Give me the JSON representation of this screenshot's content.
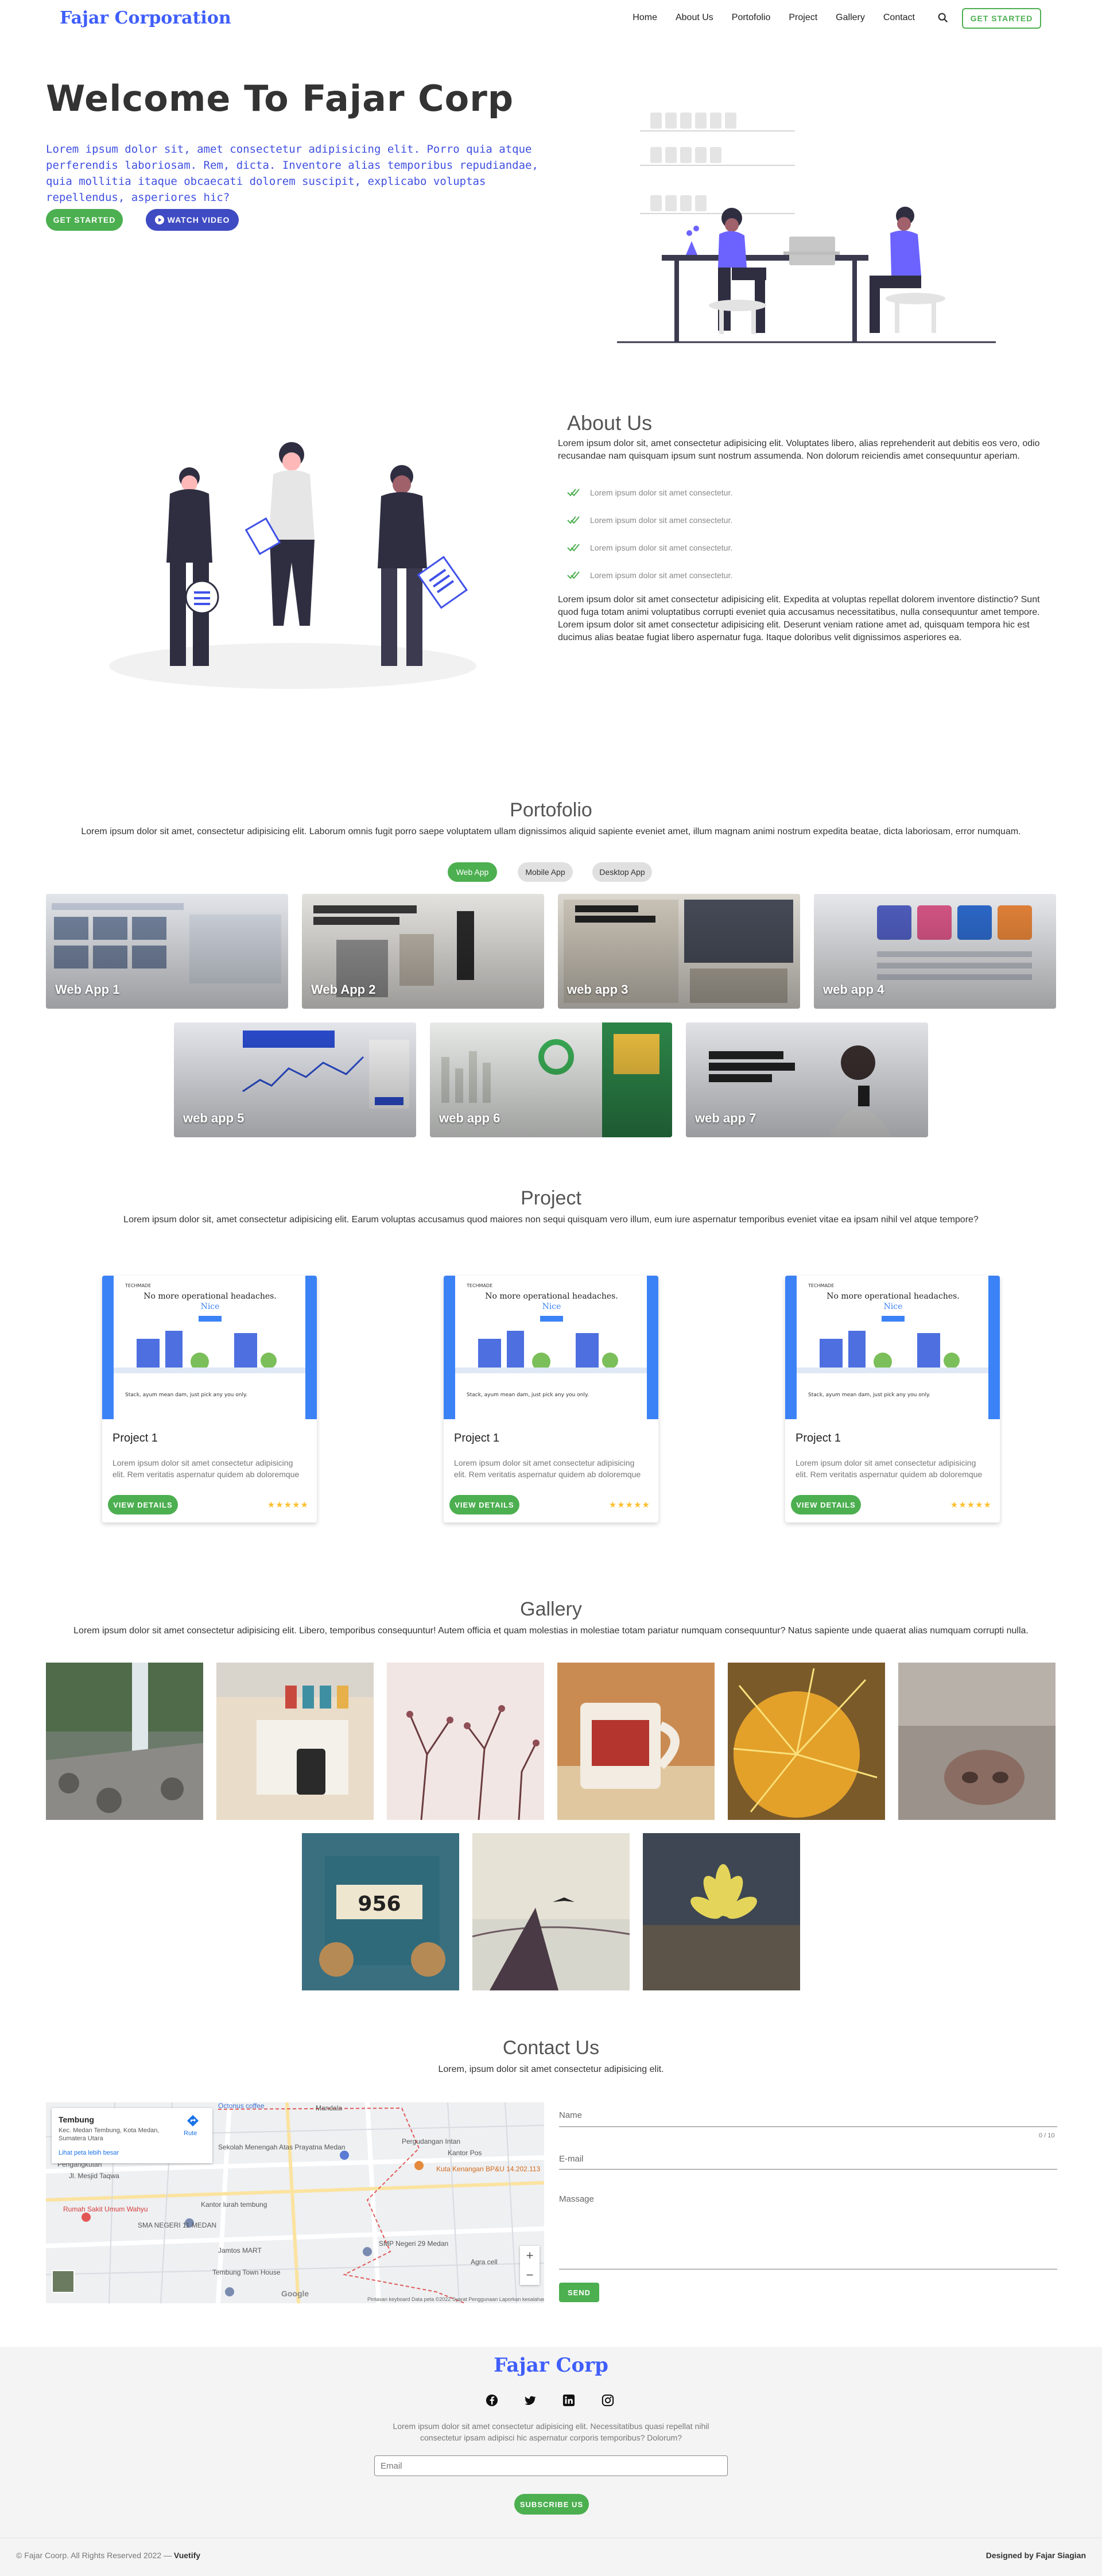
{
  "nav": {
    "brand": "Fajar Corporation",
    "items": [
      "Home",
      "About Us",
      "Portofolio",
      "Project",
      "Gallery",
      "Contact"
    ],
    "cta": "GET STARTED"
  },
  "hero": {
    "title": "Welcome To Fajar Corp",
    "subtitle": "Lorem ipsum dolor sit, amet consectetur adipisicing elit. Porro quia atque perferendis laboriosam. Rem, dicta. Inventore alias temporibus repudiandae, quia mollitia itaque obcaecati dolorem suscipit, explicabo voluptas repellendus, asperiores hic?",
    "get_started": "GET STARTED",
    "watch_video": "WATCH VIDEO"
  },
  "about": {
    "title": "About Us",
    "intro": "Lorem ipsum dolor sit, amet consectetur adipisicing elit. Voluptates libero, alias reprehenderit aut debitis eos vero, odio recusandae nam quisquam ipsum sunt nostrum assumenda. Non dolorum reiciendis amet consequuntur aperiam.",
    "checks": [
      "Lorem ipsum dolor sit amet consectetur.",
      "Lorem ipsum dolor sit amet consectetur.",
      "Lorem ipsum dolor sit amet consectetur.",
      "Lorem ipsum dolor sit amet consectetur."
    ],
    "outro": "Lorem ipsum dolor sit amet consectetur adipisicing elit. Expedita at voluptas repellat dolorem inventore distinctio? Sunt quod fuga totam animi voluptatibus corrupti eveniet quia accusamus necessitatibus, nulla consequuntur amet tempore. Lorem ipsum dolor sit amet consectetur adipisicing elit. Deserunt veniam ratione amet ad, quisquam tempora hic est ducimus alias beatae fugiat libero aspernatur fuga. Itaque doloribus velit dignissimos asperiores ea."
  },
  "portfolio": {
    "title": "Portofolio",
    "desc": "Lorem ipsum dolor sit amet, consectetur adipisicing elit. Laborum omnis fugit porro saepe voluptatem ullam dignissimos aliquid sapiente eveniet amet, illum magnam animi nostrum expedita beatae, dicta laboriosam, error numquam.",
    "filters": [
      "Web App",
      "Mobile App",
      "Desktop App"
    ],
    "cards": [
      "Web App 1",
      "Web App 2",
      "web app 3",
      "web app 4",
      "web app 5",
      "web app 6",
      "web app 7"
    ]
  },
  "project": {
    "title": "Project",
    "desc": "Lorem ipsum dolor sit, amet consectetur adipisicing elit. Earum voluptas accusamus quod maiores non sequi quisquam vero illum, eum iure aspernatur temporibus eveniet vitae ea ipsam nihil vel atque tempore?",
    "cards": [
      {
        "title": "Project 1",
        "text": "Lorem ipsum dolor sit amet consectetur adipisicing elit. Rem veritatis aspernatur quidem ab doloremque",
        "button": "VIEW DETAILS",
        "stars": "★★★★★"
      },
      {
        "title": "Project 1",
        "text": "Lorem ipsum dolor sit amet consectetur adipisicing elit. Rem veritatis aspernatur quidem ab doloremque",
        "button": "VIEW DETAILS",
        "stars": "★★★★★"
      },
      {
        "title": "Project 1",
        "text": "Lorem ipsum dolor sit amet consectetur adipisicing elit. Rem veritatis aspernatur quidem ab doloremque",
        "button": "VIEW DETAILS",
        "stars": "★★★★★"
      }
    ],
    "mock_headline": "No more operational headaches.",
    "mock_headline_accent": "Nice",
    "mock_sub": "Stack, ayum mean dam, just pick any you only.",
    "mock_logo": "TECHMADE"
  },
  "gallery": {
    "title": "Gallery",
    "desc": "Lorem ipsum dolor sit amet consectetur adipisicing elit. Libero, temporibus consequuntur! Autem officia et quam molestias in molestiae totam pariatur numquam consequuntur? Natus sapiente unde quaerat alias numquam corrupti nulla."
  },
  "contact": {
    "title": "Contact Us",
    "desc": "Lorem, ipsum dolor sit amet consectetur adipisicing elit.",
    "name_label": "Name",
    "counter": "0 / 10",
    "email_label": "E-mail",
    "message_label": "Massage",
    "send": "SEND",
    "map": {
      "place": "Tembung",
      "address": "Kec. Medan Tembung, Kota Medan, Sumatera Utara",
      "route": "Rute",
      "bigger": "Lihat peta lebih besar",
      "labels": [
        "Sekolah Menengah Atas Prayatna Medan",
        "Pergudangan Intan",
        "Kantor Pos",
        "Kuta Kenangan BP&U 14.202.113",
        "Rumah Sakit Umum Wahyu",
        "Kantor lurah tembung",
        "SMA NEGERI 11 MEDAN",
        "Jamtos MART",
        "SMP Negeri 29 Medan",
        "Agra cell",
        "Tembung Town House",
        "Octonus coffee",
        "Mandala",
        "Pengangkutan",
        "Jl. Mesjid Taqwa"
      ],
      "footer": "Pintasan keyboard   Data peta ©2022   Syarat Penggunaan   Laporkan kesalahan peta"
    }
  },
  "footer": {
    "brand": "Fajar Corp",
    "text": "Lorem ipsum dolor sit amet consectetur adipisicing elit. Necessitatibus quasi repellat nihil consectetur ipsam adipisci hic aspernatur corporis temporibus? Dolorum?",
    "email_placeholder": "Email",
    "subscribe": "SUBSCRIBE US",
    "copyright": "© Fajar Coorp. All Rights Reserved 2022 —",
    "copyright_strong": "Vuetify",
    "designed": "Designed by Fajar Siagian"
  },
  "colors": {
    "brand": "#3f5efb",
    "accent_green": "#4caf50",
    "button_navy": "#3f4bc2"
  }
}
